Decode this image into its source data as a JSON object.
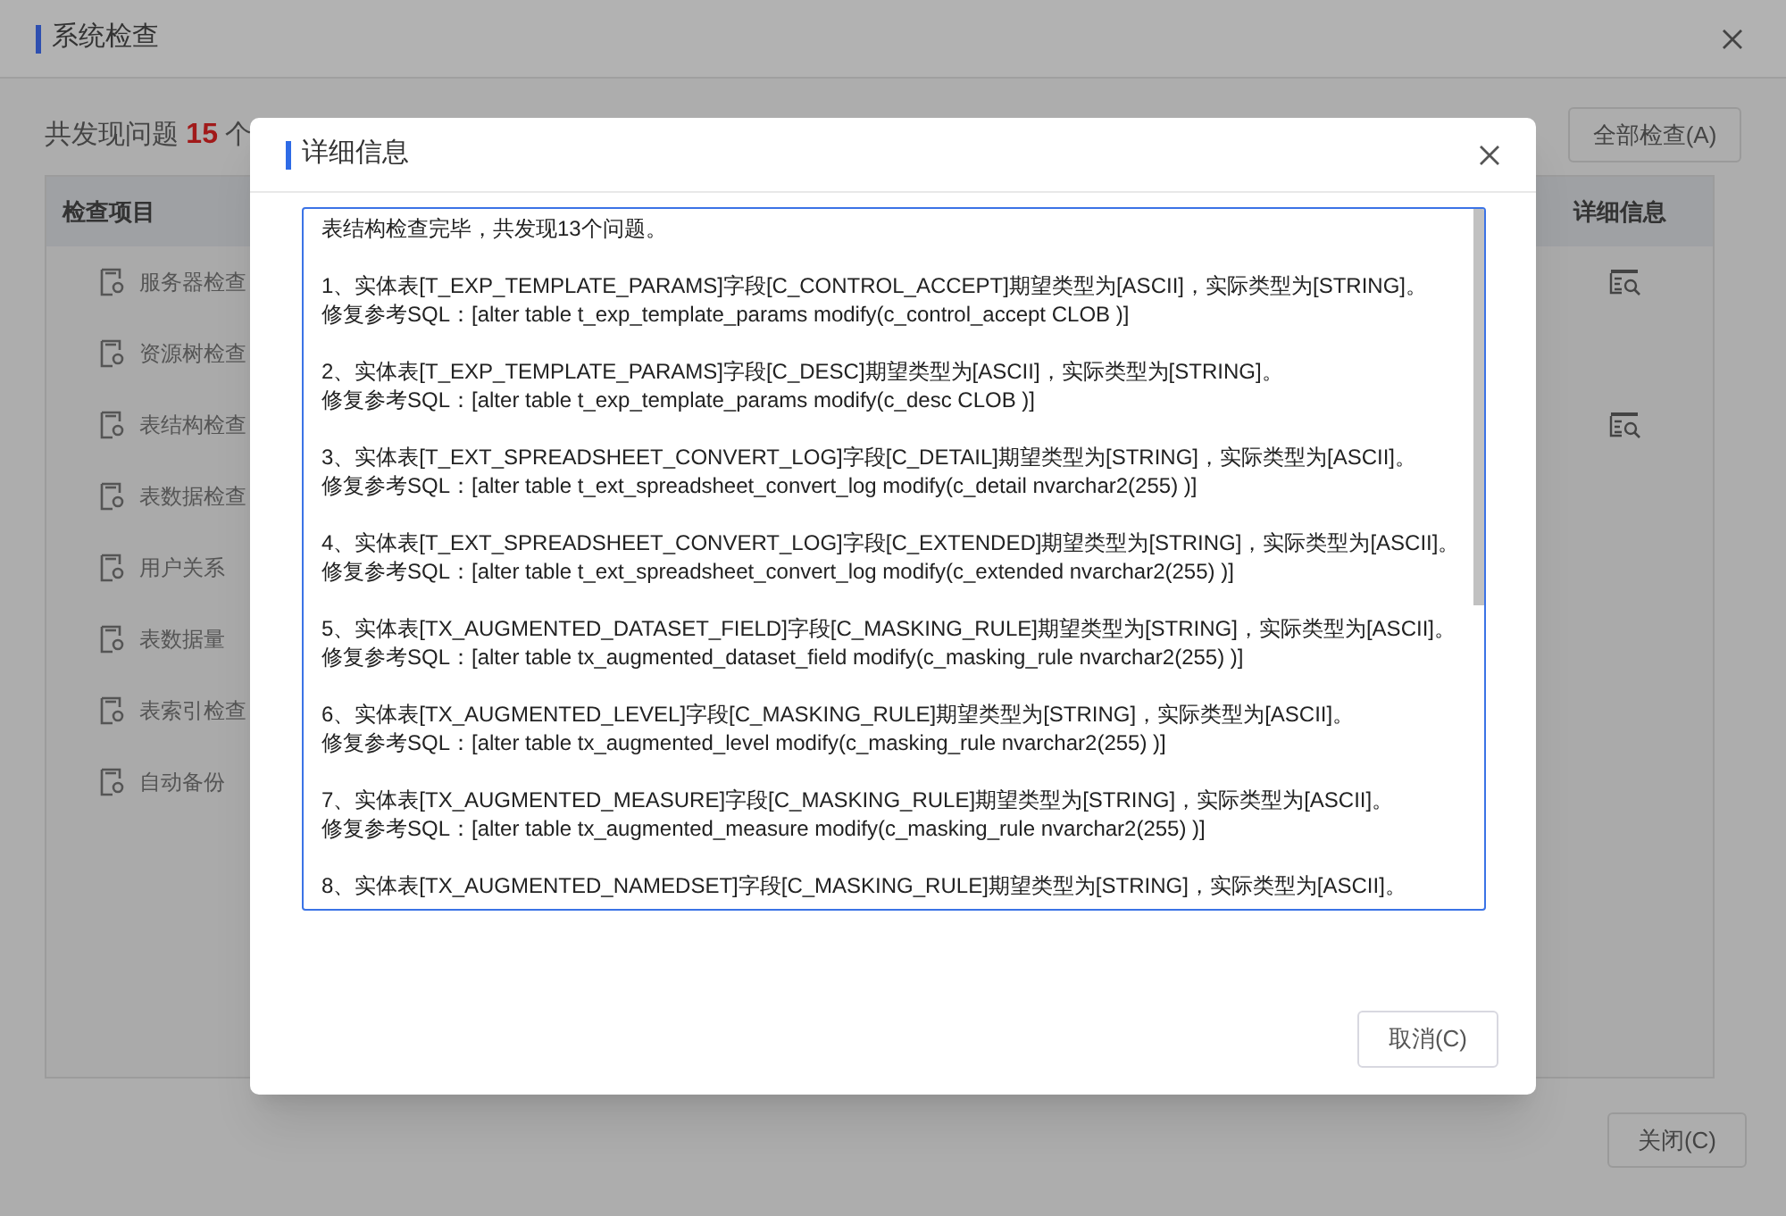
{
  "window": {
    "title": "系统检查"
  },
  "summary": {
    "prefix": "共发现问题",
    "count": "15",
    "suffix": "个"
  },
  "check_all_button": "全部检查(A)",
  "table": {
    "columns": [
      "检查项目",
      "详细信息"
    ],
    "rows": [
      {
        "label": "服务器检查",
        "has_detail": true
      },
      {
        "label": "资源树检查",
        "has_detail": false
      },
      {
        "label": "表结构检查",
        "has_detail": true
      },
      {
        "label": "表数据检查",
        "has_detail": false
      },
      {
        "label": "用户关系",
        "has_detail": false
      },
      {
        "label": "表数据量",
        "has_detail": false
      },
      {
        "label": "表索引检查",
        "has_detail": false
      },
      {
        "label": "自动备份",
        "has_detail": false
      }
    ]
  },
  "close_button": "关闭(C)",
  "dialog": {
    "title": "详细信息",
    "summary": "表结构检查完毕，共发现13个问题。",
    "issues": [
      {
        "issue": "1、实体表[T_EXP_TEMPLATE_PARAMS]字段[C_CONTROL_ACCEPT]期望类型为[ASCII]，实际类型为[STRING]。",
        "sql": "修复参考SQL：[alter table t_exp_template_params modify(c_control_accept CLOB )]"
      },
      {
        "issue": "2、实体表[T_EXP_TEMPLATE_PARAMS]字段[C_DESC]期望类型为[ASCII]，实际类型为[STRING]。",
        "sql": "修复参考SQL：[alter table t_exp_template_params modify(c_desc CLOB )]"
      },
      {
        "issue": "3、实体表[T_EXT_SPREADSHEET_CONVERT_LOG]字段[C_DETAIL]期望类型为[STRING]，实际类型为[ASCII]。",
        "sql": "修复参考SQL：[alter table t_ext_spreadsheet_convert_log modify(c_detail nvarchar2(255) )]"
      },
      {
        "issue": "4、实体表[T_EXT_SPREADSHEET_CONVERT_LOG]字段[C_EXTENDED]期望类型为[STRING]，实际类型为[ASCII]。",
        "sql": "修复参考SQL：[alter table t_ext_spreadsheet_convert_log modify(c_extended nvarchar2(255) )]"
      },
      {
        "issue": "5、实体表[TX_AUGMENTED_DATASET_FIELD]字段[C_MASKING_RULE]期望类型为[STRING]，实际类型为[ASCII]。",
        "sql": "修复参考SQL：[alter table tx_augmented_dataset_field modify(c_masking_rule nvarchar2(255) )]"
      },
      {
        "issue": "6、实体表[TX_AUGMENTED_LEVEL]字段[C_MASKING_RULE]期望类型为[STRING]，实际类型为[ASCII]。",
        "sql": "修复参考SQL：[alter table tx_augmented_level modify(c_masking_rule nvarchar2(255) )]"
      },
      {
        "issue": "7、实体表[TX_AUGMENTED_MEASURE]字段[C_MASKING_RULE]期望类型为[STRING]，实际类型为[ASCII]。",
        "sql": "修复参考SQL：[alter table tx_augmented_measure modify(c_masking_rule nvarchar2(255) )]"
      },
      {
        "issue": "8、实体表[TX_AUGMENTED_NAMEDSET]字段[C_MASKING_RULE]期望类型为[STRING]，实际类型为[ASCII]。"
      }
    ]
  },
  "cancel_button": "取消(C)"
}
